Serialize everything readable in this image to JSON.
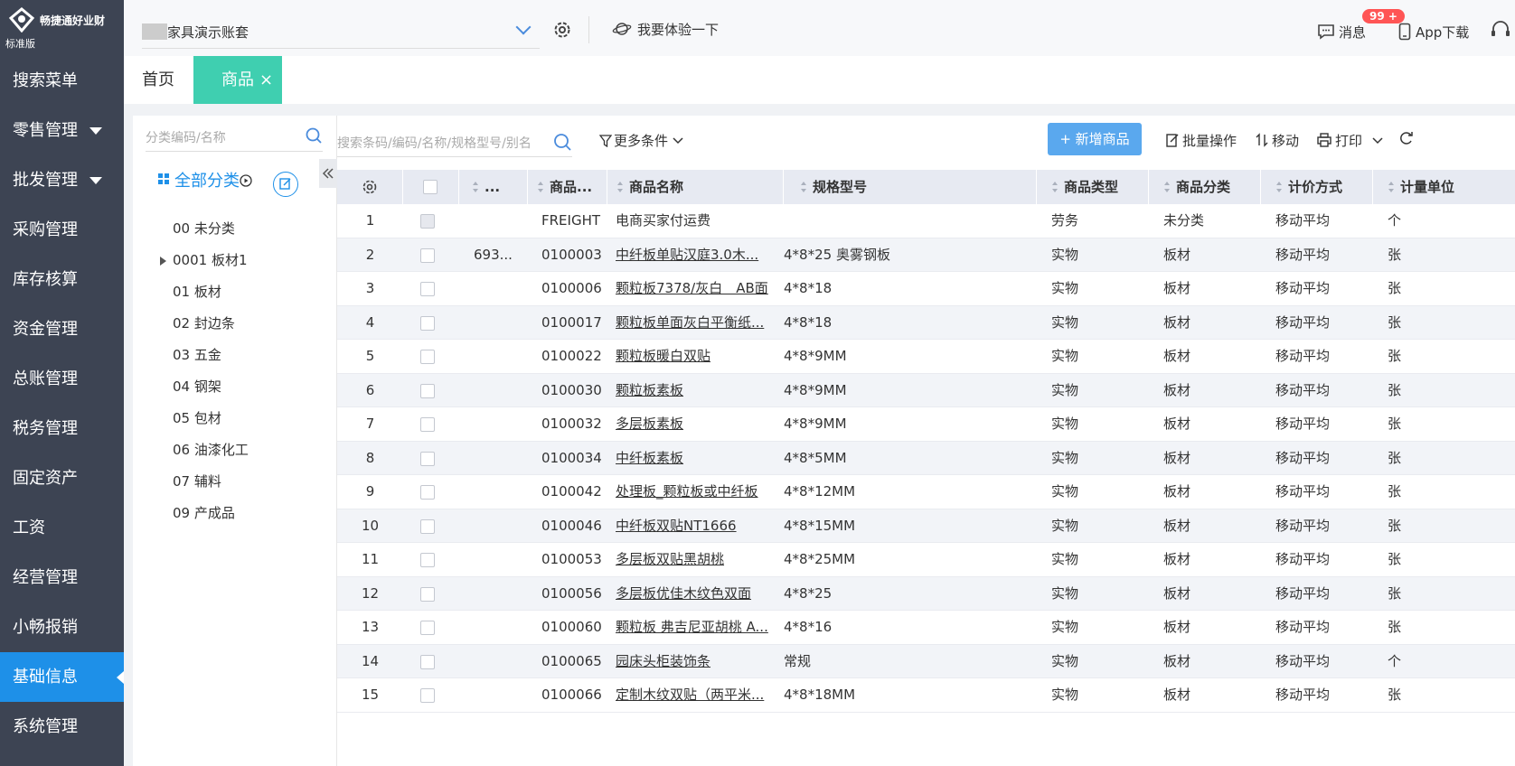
{
  "brand": {
    "name": "畅捷通好业财",
    "edition": "标准版"
  },
  "nav": {
    "items": [
      {
        "label": "搜索菜单",
        "caret": false
      },
      {
        "label": "零售管理",
        "caret": true
      },
      {
        "label": "批发管理",
        "caret": true
      },
      {
        "label": "采购管理",
        "caret": false
      },
      {
        "label": "库存核算",
        "caret": false
      },
      {
        "label": "资金管理",
        "caret": false
      },
      {
        "label": "总账管理",
        "caret": false
      },
      {
        "label": "税务管理",
        "caret": false
      },
      {
        "label": "固定资产",
        "caret": false
      },
      {
        "label": "工资",
        "caret": false
      },
      {
        "label": "经营管理",
        "caret": false
      },
      {
        "label": "小畅报销",
        "caret": false
      },
      {
        "label": "基础信息",
        "caret": false,
        "active": true
      },
      {
        "label": "系统管理",
        "caret": false
      }
    ]
  },
  "topbar": {
    "account": "家具演示账套",
    "try_label": "我要体验一下",
    "messages_label": "消息",
    "messages_badge": "99 +",
    "app_label": "App下载"
  },
  "tabs": {
    "home": "首页",
    "goods": "商品",
    "close": "×"
  },
  "category": {
    "search_placeholder": "分类编码/名称",
    "all_label": "全部分类",
    "items": [
      {
        "label": "00 未分类",
        "expandable": false
      },
      {
        "label": "0001 板材1",
        "expandable": true
      },
      {
        "label": "01 板材",
        "expandable": false
      },
      {
        "label": "02 封边条",
        "expandable": false
      },
      {
        "label": "03 五金",
        "expandable": false
      },
      {
        "label": "04 钢架",
        "expandable": false
      },
      {
        "label": "05 包材",
        "expandable": false
      },
      {
        "label": "06 油漆化工",
        "expandable": false
      },
      {
        "label": "07 辅料",
        "expandable": false
      },
      {
        "label": "09 产成品",
        "expandable": false
      }
    ]
  },
  "toolbar": {
    "search_placeholder": "搜索条码/编码/名称/规格型号/别名",
    "more_label": "更多条件",
    "new_label": "+ 新增商品",
    "batch_label": "批量操作",
    "move_label": "移动",
    "print_label": "打印"
  },
  "table": {
    "headers": {
      "barcode": "...",
      "code": "商品...",
      "name": "商品名称",
      "spec": "规格型号",
      "type": "商品类型",
      "category": "商品分类",
      "pricing": "计价方式",
      "unit": "计量单位"
    },
    "rows": [
      {
        "no": "1",
        "barcode": "",
        "code": "FREIGHT",
        "name": "电商买家付运费",
        "spec": "",
        "type": "劳务",
        "category": "未分类",
        "pricing": "移动平均",
        "unit": "个",
        "link": false,
        "disabled": true
      },
      {
        "no": "2",
        "barcode": "693...",
        "code": "0100003",
        "name": "中纤板单贴汉庭3.0木...",
        "spec": "4*8*25 奥雾钢板",
        "type": "实物",
        "category": "板材",
        "pricing": "移动平均",
        "unit": "张",
        "link": true
      },
      {
        "no": "3",
        "barcode": "",
        "code": "0100006",
        "name": "颗粒板7378/灰白　AB面",
        "spec": "4*8*18",
        "type": "实物",
        "category": "板材",
        "pricing": "移动平均",
        "unit": "张",
        "link": true
      },
      {
        "no": "4",
        "barcode": "",
        "code": "0100017",
        "name": "颗粒板单面灰白平衡纸...",
        "spec": "4*8*18",
        "type": "实物",
        "category": "板材",
        "pricing": "移动平均",
        "unit": "张",
        "link": true
      },
      {
        "no": "5",
        "barcode": "",
        "code": "0100022",
        "name": "颗粒板暖白双贴",
        "spec": "4*8*9MM",
        "type": "实物",
        "category": "板材",
        "pricing": "移动平均",
        "unit": "张",
        "link": true
      },
      {
        "no": "6",
        "barcode": "",
        "code": "0100030",
        "name": "颗粒板素板",
        "spec": "4*8*9MM",
        "type": "实物",
        "category": "板材",
        "pricing": "移动平均",
        "unit": "张",
        "link": true
      },
      {
        "no": "7",
        "barcode": "",
        "code": "0100032",
        "name": "多层板素板",
        "spec": "4*8*9MM",
        "type": "实物",
        "category": "板材",
        "pricing": "移动平均",
        "unit": "张",
        "link": true
      },
      {
        "no": "8",
        "barcode": "",
        "code": "0100034",
        "name": "中纤板素板",
        "spec": "4*8*5MM",
        "type": "实物",
        "category": "板材",
        "pricing": "移动平均",
        "unit": "张",
        "link": true
      },
      {
        "no": "9",
        "barcode": "",
        "code": "0100042",
        "name": "处理板_颗粒板或中纤板",
        "spec": "4*8*12MM",
        "type": "实物",
        "category": "板材",
        "pricing": "移动平均",
        "unit": "张",
        "link": true
      },
      {
        "no": "10",
        "barcode": "",
        "code": "0100046",
        "name": "中纤板双贴NT1666",
        "spec": "4*8*15MM",
        "type": "实物",
        "category": "板材",
        "pricing": "移动平均",
        "unit": "张",
        "link": true
      },
      {
        "no": "11",
        "barcode": "",
        "code": "0100053",
        "name": "多层板双贴黑胡桃",
        "spec": "4*8*25MM",
        "type": "实物",
        "category": "板材",
        "pricing": "移动平均",
        "unit": "张",
        "link": true
      },
      {
        "no": "12",
        "barcode": "",
        "code": "0100056",
        "name": "多层板优佳木纹色双面",
        "spec": "4*8*25",
        "type": "实物",
        "category": "板材",
        "pricing": "移动平均",
        "unit": "张",
        "link": true
      },
      {
        "no": "13",
        "barcode": "",
        "code": "0100060",
        "name": "颗粒板 弗吉尼亚胡桃 A...",
        "spec": "4*8*16",
        "type": "实物",
        "category": "板材",
        "pricing": "移动平均",
        "unit": "张",
        "link": true
      },
      {
        "no": "14",
        "barcode": "",
        "code": "0100065",
        "name": "园床头柜装饰条",
        "spec": "常规",
        "type": "实物",
        "category": "板材",
        "pricing": "移动平均",
        "unit": "个",
        "link": true
      },
      {
        "no": "15",
        "barcode": "",
        "code": "0100066",
        "name": "定制木纹双贴（两平米...",
        "spec": "4*8*18MM",
        "type": "实物",
        "category": "板材",
        "pricing": "移动平均",
        "unit": "张",
        "link": true
      }
    ]
  },
  "colors": {
    "nav_bg": "#3d4453",
    "accent": "#1e90e8",
    "tab_active": "#3fcfb0",
    "button": "#5aa8ee",
    "badge": "#ff5555"
  }
}
